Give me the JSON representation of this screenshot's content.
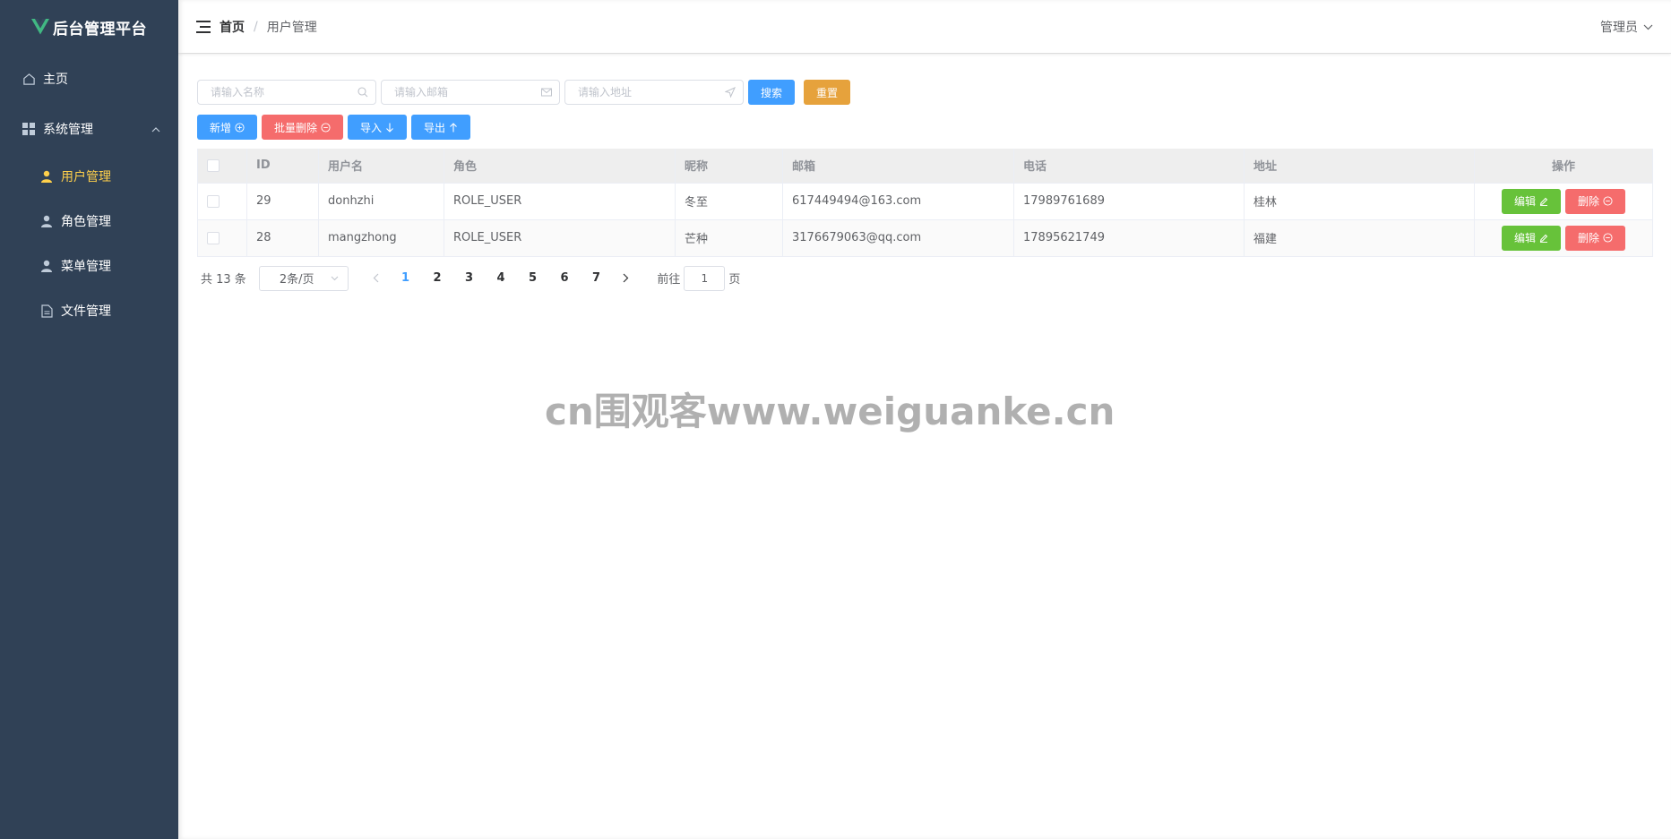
{
  "app": {
    "title": "后台管理平台"
  },
  "sidebar": {
    "home": {
      "label": "主页",
      "icon": "home-icon"
    },
    "system": {
      "label": "系统管理",
      "icon": "grid-icon",
      "expanded": true
    },
    "items": [
      {
        "label": "用户管理",
        "icon": "user-icon",
        "active": true
      },
      {
        "label": "角色管理",
        "icon": "user-icon",
        "active": false
      },
      {
        "label": "菜单管理",
        "icon": "user-icon",
        "active": false
      },
      {
        "label": "文件管理",
        "icon": "document-icon",
        "active": false
      }
    ]
  },
  "header": {
    "breadcrumb": {
      "home": "首页",
      "separator": "/",
      "current": "用户管理"
    },
    "user": "管理员"
  },
  "search": {
    "name_placeholder": "请输入名称",
    "email_placeholder": "请输入邮箱",
    "address_placeholder": "请输入地址",
    "search_label": "搜索",
    "reset_label": "重置"
  },
  "actions": {
    "add_label": "新增",
    "batch_delete_label": "批量删除",
    "import_label": "导入",
    "export_label": "导出"
  },
  "table": {
    "columns": [
      "ID",
      "用户名",
      "角色",
      "昵称",
      "邮箱",
      "电话",
      "地址",
      "操作"
    ],
    "rows": [
      {
        "id": "29",
        "username": "donhzhi",
        "role": "ROLE_USER",
        "nickname": "冬至",
        "email": "617449494@163.com",
        "phone": "17989761689",
        "address": "桂林"
      },
      {
        "id": "28",
        "username": "mangzhong",
        "role": "ROLE_USER",
        "nickname": "芒种",
        "email": "3176679063@qq.com",
        "phone": "17895621749",
        "address": "福建"
      }
    ],
    "edit_label": "编辑",
    "delete_label": "删除"
  },
  "pagination": {
    "total": "共 13 条",
    "page_size": "2条/页",
    "pages": [
      "1",
      "2",
      "3",
      "4",
      "5",
      "6",
      "7"
    ],
    "current": "1",
    "goto_prefix": "前往",
    "goto_value": "1",
    "goto_suffix": "页"
  },
  "watermark": "cn围观客www.weiguanke.cn",
  "colors": {
    "sidebar_bg": "#304156",
    "active_menu": "#ffd04b",
    "primary": "#409eff",
    "warning": "#e6a23c",
    "danger": "#f56c6c",
    "success": "#67c23a"
  }
}
